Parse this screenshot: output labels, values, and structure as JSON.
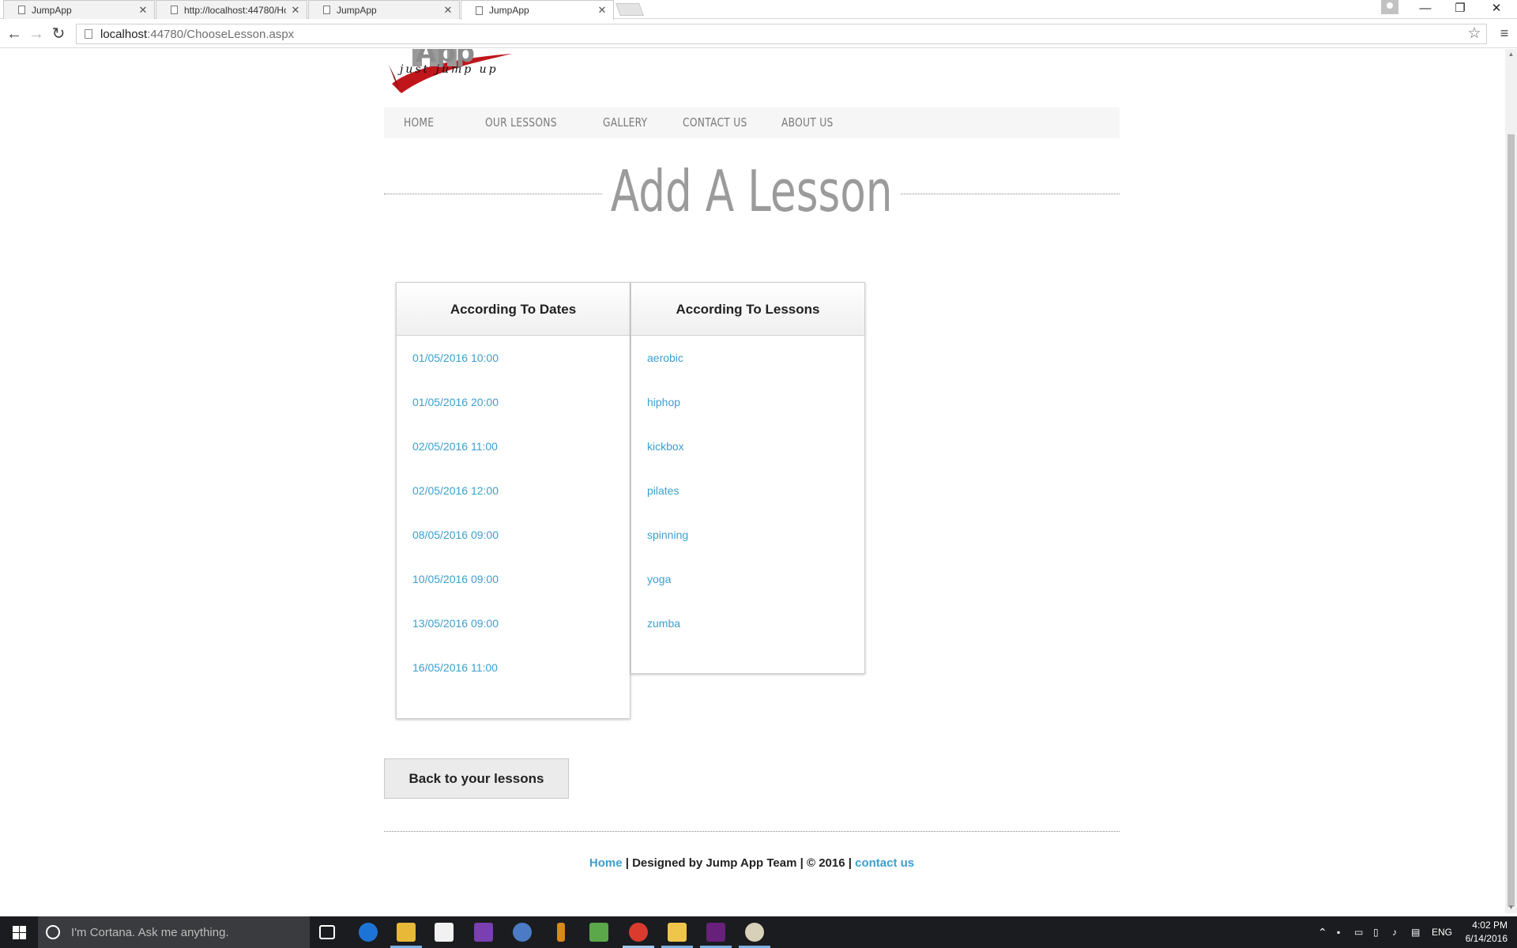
{
  "browser": {
    "tabs": [
      {
        "title": "JumpApp",
        "active": false
      },
      {
        "title": "http://localhost:44780/Ho",
        "active": false
      },
      {
        "title": "JumpApp",
        "active": false
      },
      {
        "title": "JumpApp",
        "active": true
      }
    ],
    "address": {
      "host": "localhost",
      "path": ":44780/ChooseLesson.aspx"
    }
  },
  "site": {
    "logo_text": "App",
    "tagline": "just jump up",
    "nav": [
      "HOME",
      "OUR LESSONS",
      "GALLERY",
      "CONTACT US",
      "ABOUT US"
    ],
    "page_title": "Add A Lesson",
    "dates_panel": {
      "title": "According To Dates",
      "items": [
        "01/05/2016 10:00",
        "01/05/2016 20:00",
        "02/05/2016 11:00",
        "02/05/2016 12:00",
        "08/05/2016 09:00",
        "10/05/2016 09:00",
        "13/05/2016 09:00",
        "16/05/2016 11:00"
      ]
    },
    "lessons_panel": {
      "title": "According To Lessons",
      "items": [
        "aerobic",
        "hiphop",
        "kickbox",
        "pilates",
        "spinning",
        "yoga",
        "zumba"
      ]
    },
    "back_button": "Back to your lessons",
    "footer": {
      "home": "Home",
      "middle": " | Designed by Jump App Team | © 2016 | ",
      "contact": "contact us"
    }
  },
  "taskbar": {
    "search_placeholder": "I'm Cortana. Ask me anything.",
    "language": "ENG",
    "time": "4:02 PM",
    "date": "6/14/2016"
  },
  "colors": {
    "link": "#3c9fd0",
    "title_gray": "#9b9b9b",
    "nav_bg": "#f6f6f6",
    "taskbar": "#1b1c1f"
  }
}
